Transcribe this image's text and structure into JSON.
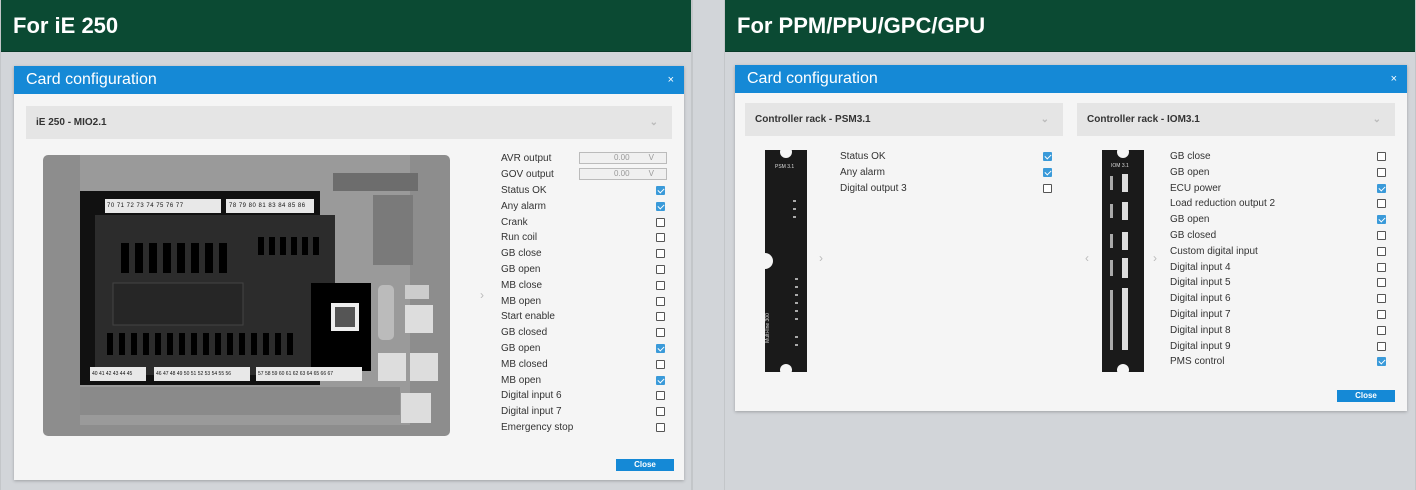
{
  "left_panel": {
    "header": "For iE 250",
    "dialog": {
      "title": "Card configuration",
      "close_icon": "×",
      "card_select": "iE 250 - MIO2.1",
      "chevron": "⌄",
      "analog_outputs": [
        {
          "label": "AVR output",
          "value": "0.00",
          "unit": "V"
        },
        {
          "label": "GOV output",
          "value": "0.00",
          "unit": "V"
        }
      ],
      "items": [
        {
          "label": "Status OK",
          "checked": true
        },
        {
          "label": "Any alarm",
          "checked": true
        },
        {
          "label": "Crank",
          "checked": false
        },
        {
          "label": "Run coil",
          "checked": false
        },
        {
          "label": "GB close",
          "checked": false
        },
        {
          "label": "GB open",
          "checked": false
        },
        {
          "label": "MB close",
          "checked": false
        },
        {
          "label": "MB open",
          "checked": false
        },
        {
          "label": "Start enable",
          "checked": false
        },
        {
          "label": "GB closed",
          "checked": false
        },
        {
          "label": "GB open",
          "checked": true
        },
        {
          "label": "MB closed",
          "checked": false
        },
        {
          "label": "MB open",
          "checked": true
        },
        {
          "label": "Digital input 6",
          "checked": false
        },
        {
          "label": "Digital input 7",
          "checked": false
        },
        {
          "label": "Emergency stop",
          "checked": false
        }
      ],
      "terminals_top_a": "70 71 72 73 74 75 76 77",
      "terminals_top_b": "78 79 80 81 83 84 85 86",
      "terminals_bottom_a": "40 41 42 43 44 45",
      "terminals_bottom_b": "46 47 48 49 50 51 52 53 54 55 56",
      "terminals_bottom_c": "57 58 59 60 61 62 63 64 65 66 67",
      "next_arrow": "›",
      "close_label": "Close"
    }
  },
  "right_panel": {
    "header": "For PPM/PPU/GPC/GPU",
    "dialog": {
      "title": "Card configuration",
      "close_icon": "×",
      "psm": {
        "card_select": "Controller rack - PSM3.1",
        "module_label": "PSM 3.1",
        "side_label": "Multi-line 300",
        "items": [
          {
            "label": "Status OK",
            "checked": true
          },
          {
            "label": "Any alarm",
            "checked": true
          },
          {
            "label": "Digital output 3",
            "checked": false
          }
        ]
      },
      "iom": {
        "card_select": "Controller rack - IOM3.1",
        "module_label": "IOM 3.1",
        "items": [
          {
            "label": "GB close",
            "checked": false
          },
          {
            "label": "GB open",
            "checked": false
          },
          {
            "label": "ECU power",
            "checked": true
          },
          {
            "label": "Load reduction output 2",
            "checked": false
          },
          {
            "label": "GB open",
            "checked": true
          },
          {
            "label": "GB closed",
            "checked": false
          },
          {
            "label": "Custom digital input",
            "checked": false
          },
          {
            "label": "Digital input 4",
            "checked": false
          },
          {
            "label": "Digital input 5",
            "checked": false
          },
          {
            "label": "Digital input 6",
            "checked": false
          },
          {
            "label": "Digital input 7",
            "checked": false
          },
          {
            "label": "Digital input 8",
            "checked": false
          },
          {
            "label": "Digital input 9",
            "checked": false
          },
          {
            "label": "PMS control",
            "checked": true
          }
        ]
      },
      "chevron": "⌄",
      "prev_arrow": "‹",
      "next_arrow": "›",
      "close_label": "Close"
    }
  }
}
